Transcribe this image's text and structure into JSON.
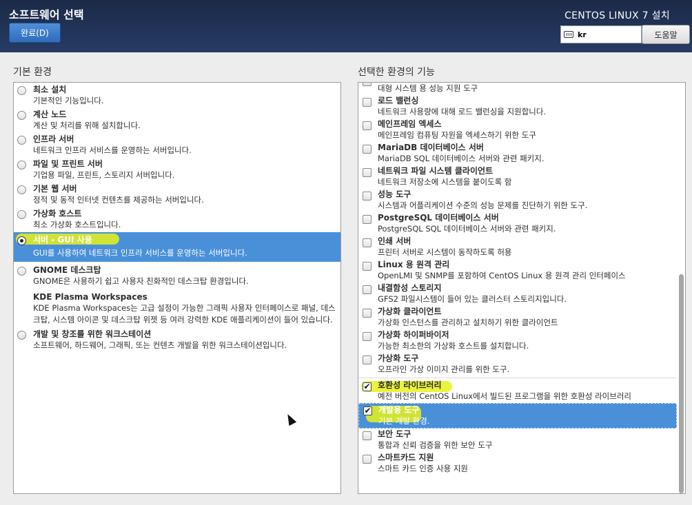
{
  "header": {
    "title": "소프트웨어 선택",
    "done_label": "완료(D)",
    "install_title": "CENTOS LINUX 7 설치",
    "keyboard_value": "kr",
    "help_label": "도움말"
  },
  "environment": {
    "label": "기본 환경",
    "items": [
      {
        "title": "최소 설치",
        "desc": "기본적인 기능입니다."
      },
      {
        "title": "계산 노드",
        "desc": "계산 및 처리를 위해 설치합니다."
      },
      {
        "title": "인프라 서버",
        "desc": "네트워크 인프라 서비스를 운영하는 서버입니다."
      },
      {
        "title": "파일 및 프린트 서버",
        "desc": "기업용 파일, 프린트, 스토리지 서버입니다."
      },
      {
        "title": "기본 웹 서버",
        "desc": "정적 및 동적 인터넷 컨텐츠를 제공하는 서버입니다."
      },
      {
        "title": "가상화 호스트",
        "desc": "최소 가상화 호스트입니다."
      },
      {
        "title": "서버 - GUI 사용",
        "desc": "GUI를 사용하여 네트워크 인프라 서비스를 운영하는 서버입니다."
      },
      {
        "title": "GNOME 데스크탑",
        "desc": "GNOME은 사용하기 쉽고 사용자 친화적인 데스크탑 환경입니다."
      },
      {
        "title": "KDE Plasma Workspaces",
        "desc": "KDE Plasma Workspaces는 고급 설정이 가능한 그래픽 사용자 인터페이스로 패널, 데스크탑, 시스템 아이콘 및 데스크탑 위젯 등 여러 강력한 KDE 애플리케이션이 들어 있습니다."
      },
      {
        "title": "개발 및 창조를 위한 워크스테이션",
        "desc": "소프트웨어, 하드웨어, 그래픽, 또는 컨텐츠 개발을 위한 워크스테이션입니다."
      }
    ]
  },
  "addons": {
    "label": "선택한 환경의 기능",
    "items": [
      {
        "title": "",
        "desc": "대형 시스템 용 성능 지원 도구"
      },
      {
        "title": "로드 밸런싱",
        "desc": "네트워크 사용량에 대해 로드 밸런싱을 지원합니다."
      },
      {
        "title": "메인프레임 엑세스",
        "desc": "메인프레임 컴퓨팅 자원을 엑세스하기 위한 도구"
      },
      {
        "title": "MariaDB 데이터베이스 서버",
        "desc": "MariaDB SQL 데이터베이스 서버와 관련 패키지."
      },
      {
        "title": "네트워크 파일 시스템 클라이언트",
        "desc": "네트워크 저장소에 시스템을 붙이도록 함"
      },
      {
        "title": "성능 도구",
        "desc": "시스템과 어플리케이션 수준의 성능 문제를 진단하기 위한 도구."
      },
      {
        "title": "PostgreSQL 데이터베이스 서버",
        "desc": "PostgreSQL SQL 데이터베이스 서버와 관련 패키지."
      },
      {
        "title": "인쇄 서버",
        "desc": "프린터 서버로 시스템이 동작하도록 허용"
      },
      {
        "title": "Linux 용 원격 관리",
        "desc": "OpenLMI 및 SNMP를 포함하여 CentOS Linux 용 원격 관리 인터페이스"
      },
      {
        "title": "내결함성 스토리지",
        "desc": "GFS2 파일시스템이 들어 있는 클러스터 스토리지입니다."
      },
      {
        "title": "가상화 클라이언트",
        "desc": "가상화 인스턴스를 관리하고 설치하기 위한 클라이언트"
      },
      {
        "title": "가상화 하이퍼바이저",
        "desc": "가능한 최소한의 가상화 호스트를 설치합니다."
      },
      {
        "title": "가상화 도구",
        "desc": "오프라인 가상 이미지 관리를 위한 도구."
      },
      {
        "title": "호환성 라이브러리",
        "desc": "예전 버전의 CentOS Linux에서 빌드된 프로그램을 위한 호환성 라이브러리"
      },
      {
        "title": "개발용 도구",
        "desc": "기본 개발 환경."
      },
      {
        "title": "보안 도구",
        "desc": "통합과 신뢰 검증을 위한 보안 도구"
      },
      {
        "title": "스마트카드 지원",
        "desc": "스마트 카드 인증 사용 지원"
      }
    ]
  },
  "colors": {
    "header_bg": "#22345a",
    "accent": "#4a90d9",
    "annotation_highlight": "#e8f21a"
  }
}
